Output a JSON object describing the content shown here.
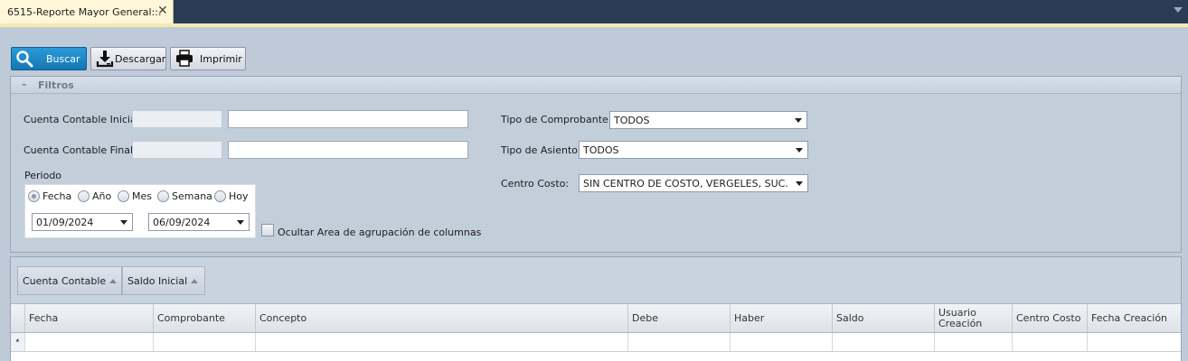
{
  "tab": {
    "title": "6515-Reporte Mayor General::.",
    "close": "✕"
  },
  "toolbar": {
    "buscar": {
      "label": "Buscar",
      "icon": "search-icon"
    },
    "descargar": {
      "label": "Descargar",
      "icon": "download-icon"
    },
    "imprimir": {
      "label": "Imprimir",
      "icon": "printer-icon"
    }
  },
  "filtros": {
    "collapse": "–",
    "title": "Filtros",
    "cuenta_inicial_label": "Cuenta Contable Inicial:",
    "cuenta_inicial_value": "",
    "cuenta_final_label": "Cuenta Contable Final:",
    "cuenta_final_value": "",
    "periodo_label": "Periodo",
    "period_options": [
      "Fecha",
      "Año",
      "Mes",
      "Semana",
      "Hoy"
    ],
    "period_selected": "Fecha",
    "fecha_desde": "01/09/2024",
    "fecha_hasta": "06/09/2024",
    "ocultar_label": "Ocultar Area de agrupación de columnas",
    "tipo_comprobante_label": "Tipo de Comprobante:",
    "tipo_comprobante_value": "TODOS",
    "tipo_asiento_label": "Tipo de Asiento:",
    "tipo_asiento_value": "TODOS",
    "centro_costo_label": "Centro Costo:",
    "centro_costo_value": "SIN CENTRO DE COSTO, VERGELES, SUC. DA..."
  },
  "grid": {
    "group_by": [
      "Cuenta Contable",
      "Saldo Inicial"
    ],
    "columns": [
      "Fecha",
      "Comprobante",
      "Concepto",
      "Debe",
      "Haber",
      "Saldo",
      "Usuario Creación",
      "Centro Costo",
      "Fecha Creación"
    ]
  },
  "colors": {
    "tabbar": "#2b3a55",
    "active_tab": "#fff7d8",
    "accent_button": "#1f88c8",
    "panel_bg": "#c3cedb"
  }
}
